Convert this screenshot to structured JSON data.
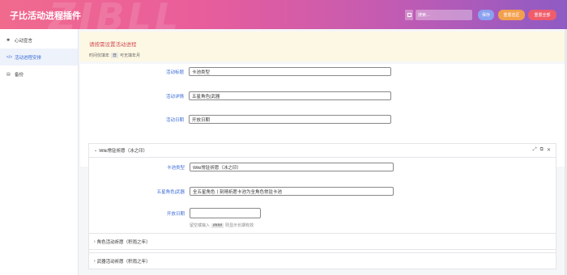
{
  "header": {
    "title": "子比活动进程插件",
    "watermark": "ZIBLL",
    "search_placeholder": "搜索...",
    "save_label": "保存",
    "reset_label": "重置选区",
    "reset_all_label": "重置全部"
  },
  "sidebar": {
    "items": [
      {
        "label": "心动宣言",
        "icon": "gear-icon",
        "active": false
      },
      {
        "label": "活动进程安排",
        "icon": "code-icon",
        "active": true
      },
      {
        "label": "备份",
        "icon": "backup-icon",
        "active": false
      }
    ]
  },
  "notice": {
    "title": "请按需设置活动进程",
    "hint_prefix": "时间仅填年",
    "hint_code": "日",
    "hint_suffix": "可无填年月"
  },
  "top_fields": [
    {
      "label": "活动标题",
      "value": "卡池类型"
    },
    {
      "label": "活动详情",
      "value": "五星角色|武器"
    },
    {
      "label": "活动日期",
      "value": "开放日期"
    }
  ],
  "panel": {
    "title": "Wiki常驻祈愿（冰之印）",
    "fields": [
      {
        "label": "卡池类型",
        "value": "Wiki常驻祈愿（冰之印）"
      },
      {
        "label": "五星角色|武器",
        "value": "全五星角色丨刻晴祈愿卡池为全角色常驻卡池"
      },
      {
        "label": "开放日期",
        "value": ""
      }
    ],
    "hint_prefix": "留空或输入",
    "hint_code": "####",
    "hint_suffix": "则显示长期有效"
  },
  "collapsed_sections": [
    {
      "title": "角色活动祈愿（积雨之年）"
    },
    {
      "title": "武器活动祈愿（积雨之年）"
    }
  ]
}
